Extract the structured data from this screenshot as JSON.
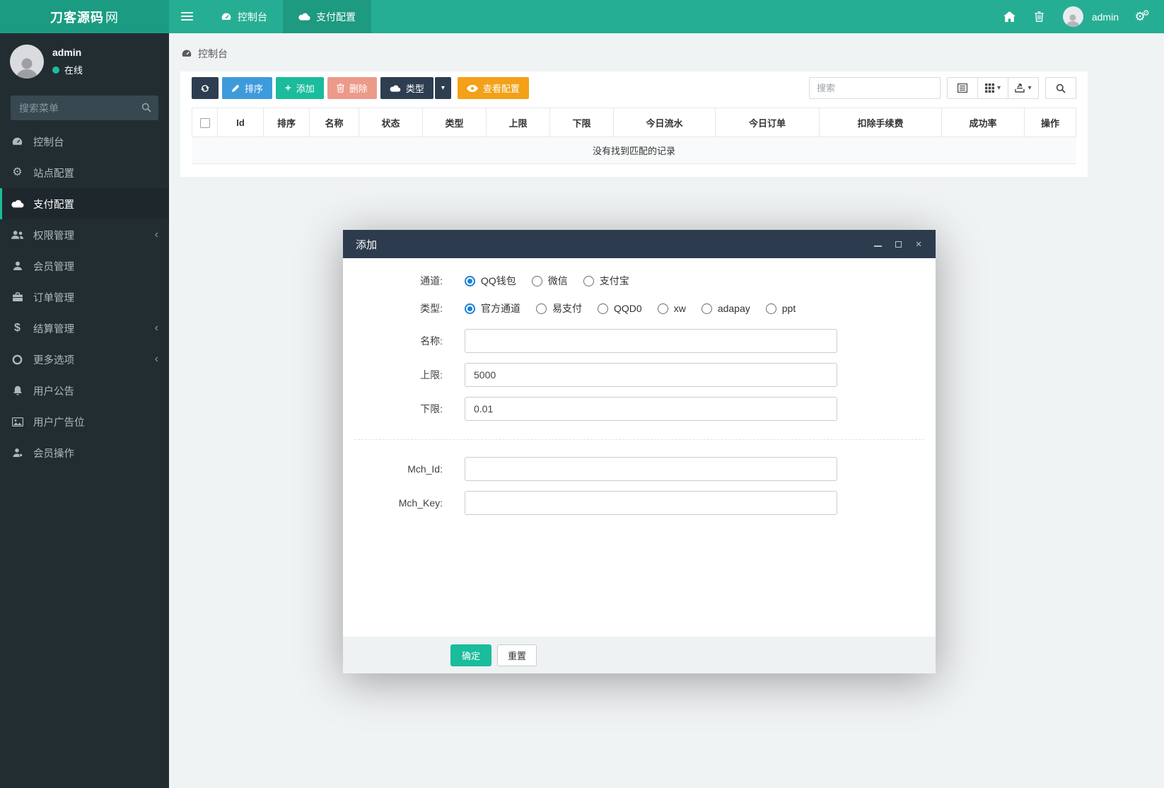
{
  "navbar": {
    "brand_bold": "刀客源码",
    "brand_light": "网",
    "tabs": [
      {
        "label": "控制台",
        "icon": "dashboard-icon",
        "active": false
      },
      {
        "label": "支付配置",
        "icon": "cloud-icon",
        "active": true
      }
    ],
    "user": "admin",
    "right_icons": [
      "home-icon",
      "trash-icon",
      "avatar",
      "cogs-icon"
    ]
  },
  "sidebar": {
    "user": {
      "name": "admin",
      "status": "在线"
    },
    "search_placeholder": "搜索菜单",
    "items": [
      {
        "label": "控制台",
        "icon": "dashboard-icon",
        "active": false,
        "expandable": false
      },
      {
        "label": "站点配置",
        "icon": "gear-icon",
        "active": false,
        "expandable": false
      },
      {
        "label": "支付配置",
        "icon": "cloud-icon",
        "active": true,
        "expandable": false
      },
      {
        "label": "权限管理",
        "icon": "users-icon",
        "active": false,
        "expandable": true
      },
      {
        "label": "会员管理",
        "icon": "user-icon",
        "active": false,
        "expandable": false
      },
      {
        "label": "订单管理",
        "icon": "briefcase-icon",
        "active": false,
        "expandable": false
      },
      {
        "label": "结算管理",
        "icon": "dollar-icon",
        "active": false,
        "expandable": true
      },
      {
        "label": "更多选项",
        "icon": "circle-icon",
        "active": false,
        "expandable": true
      },
      {
        "label": "用户公告",
        "icon": "bell-icon",
        "active": false,
        "expandable": false
      },
      {
        "label": "用户广告位",
        "icon": "image-icon",
        "active": false,
        "expandable": false
      },
      {
        "label": "会员操作",
        "icon": "user-cog-icon",
        "active": false,
        "expandable": false
      }
    ],
    "chevron": "‹"
  },
  "breadcrumb": "控制台",
  "toolbar": {
    "sort_label": "排序",
    "add_label": "添加",
    "delete_label": "删除",
    "type_label": "类型",
    "view_config_label": "查看配置",
    "search_placeholder": "搜索",
    "caret": "▾"
  },
  "table": {
    "headers": [
      "Id",
      "排序",
      "名称",
      "状态",
      "类型",
      "上限",
      "下限",
      "今日流水",
      "今日订单",
      "扣除手续费",
      "成功率",
      "操作"
    ],
    "empty_message": "没有找到匹配的记录"
  },
  "modal": {
    "title": "添加",
    "channel_label": "通道:",
    "channel_options": [
      {
        "label": "QQ钱包",
        "checked": true
      },
      {
        "label": "微信",
        "checked": false
      },
      {
        "label": "支付宝",
        "checked": false
      }
    ],
    "type_label": "类型:",
    "type_options": [
      {
        "label": "官方通道",
        "checked": true
      },
      {
        "label": "易支付",
        "checked": false
      },
      {
        "label": "QQD0",
        "checked": false
      },
      {
        "label": "xw",
        "checked": false
      },
      {
        "label": "adapay",
        "checked": false
      },
      {
        "label": "ppt",
        "checked": false
      }
    ],
    "name_label": "名称:",
    "name_value": "",
    "upper_label": "上限:",
    "upper_value": "5000",
    "lower_label": "下限:",
    "lower_value": "0.01",
    "mchid_label": "Mch_Id:",
    "mchid_value": "",
    "mchkey_label": "Mch_Key:",
    "mchkey_value": "",
    "confirm_label": "确定",
    "reset_label": "重置"
  },
  "colors": {
    "navbar": "#26ae94",
    "brand_bg": "#1b9c82",
    "sidebar_bg": "#222d32",
    "accent": "#1abc9c",
    "btn_dark": "#2d3e50",
    "btn_blue": "#3d9bdc",
    "btn_salmon": "#ec9a8a",
    "btn_orange": "#f2a118",
    "radio_checked": "#1b82d4",
    "modal_head": "#2c3b4d"
  }
}
